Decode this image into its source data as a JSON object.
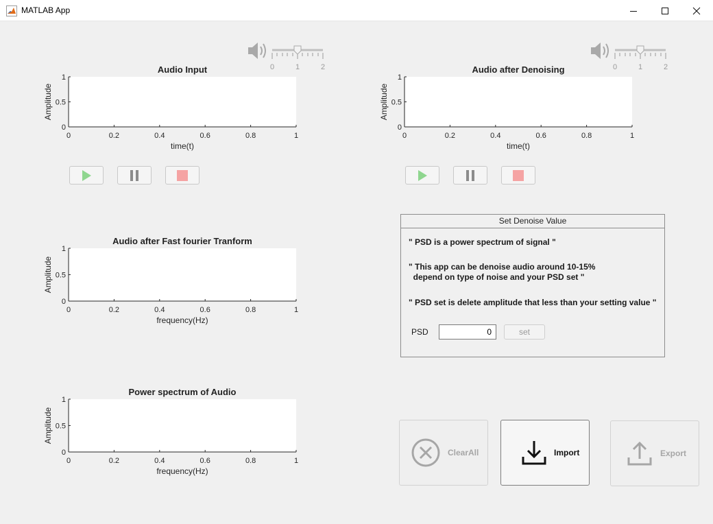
{
  "window": {
    "title": "MATLAB App"
  },
  "volume_slider_left": {
    "ticks": [
      "0",
      "1",
      "2"
    ],
    "value": 1
  },
  "volume_slider_right": {
    "ticks": [
      "0",
      "1",
      "2"
    ],
    "value": 1
  },
  "axes_input": {
    "title": "Audio Input",
    "xlabel": "time(t)",
    "ylabel": "Amplitude",
    "xticks": [
      "0",
      "0.2",
      "0.4",
      "0.6",
      "0.8",
      "1"
    ],
    "yticks": [
      "0",
      "0.5",
      "1"
    ]
  },
  "axes_denoised": {
    "title": "Audio after Denoising",
    "xlabel": "time(t)",
    "ylabel": "Amplitude",
    "xticks": [
      "0",
      "0.2",
      "0.4",
      "0.6",
      "0.8",
      "1"
    ],
    "yticks": [
      "0",
      "0.5",
      "1"
    ]
  },
  "axes_fft": {
    "title": "Audio after Fast fourier Tranform",
    "xlabel": "frequency(Hz)",
    "ylabel": "Amplitude",
    "xticks": [
      "0",
      "0.2",
      "0.4",
      "0.6",
      "0.8",
      "1"
    ],
    "yticks": [
      "0",
      "0.5",
      "1"
    ]
  },
  "axes_psd": {
    "title": "Power spectrum of Audio",
    "xlabel": "frequency(Hz)",
    "ylabel": "Amplitude",
    "xticks": [
      "0",
      "0.2",
      "0.4",
      "0.6",
      "0.8",
      "1"
    ],
    "yticks": [
      "0",
      "0.5",
      "1"
    ]
  },
  "denoise_panel": {
    "title": "Set Denoise Value",
    "line1": "\" PSD is a power spectrum of signal \"",
    "line2a": "\" This app can be denoise audio around 10-15%",
    "line2b": "  depend on type of noise and your PSD set \"",
    "line3": "\" PSD set is delete amplitude that less than your setting value \"",
    "psd_label": "PSD",
    "psd_value": "0",
    "set_label": "set"
  },
  "buttons": {
    "clear_all": "ClearAll",
    "import": "Import",
    "export": "Export"
  },
  "colors": {
    "play": "#8fd68f",
    "pause": "#8c8c8c",
    "stop": "#f5a3a3"
  }
}
